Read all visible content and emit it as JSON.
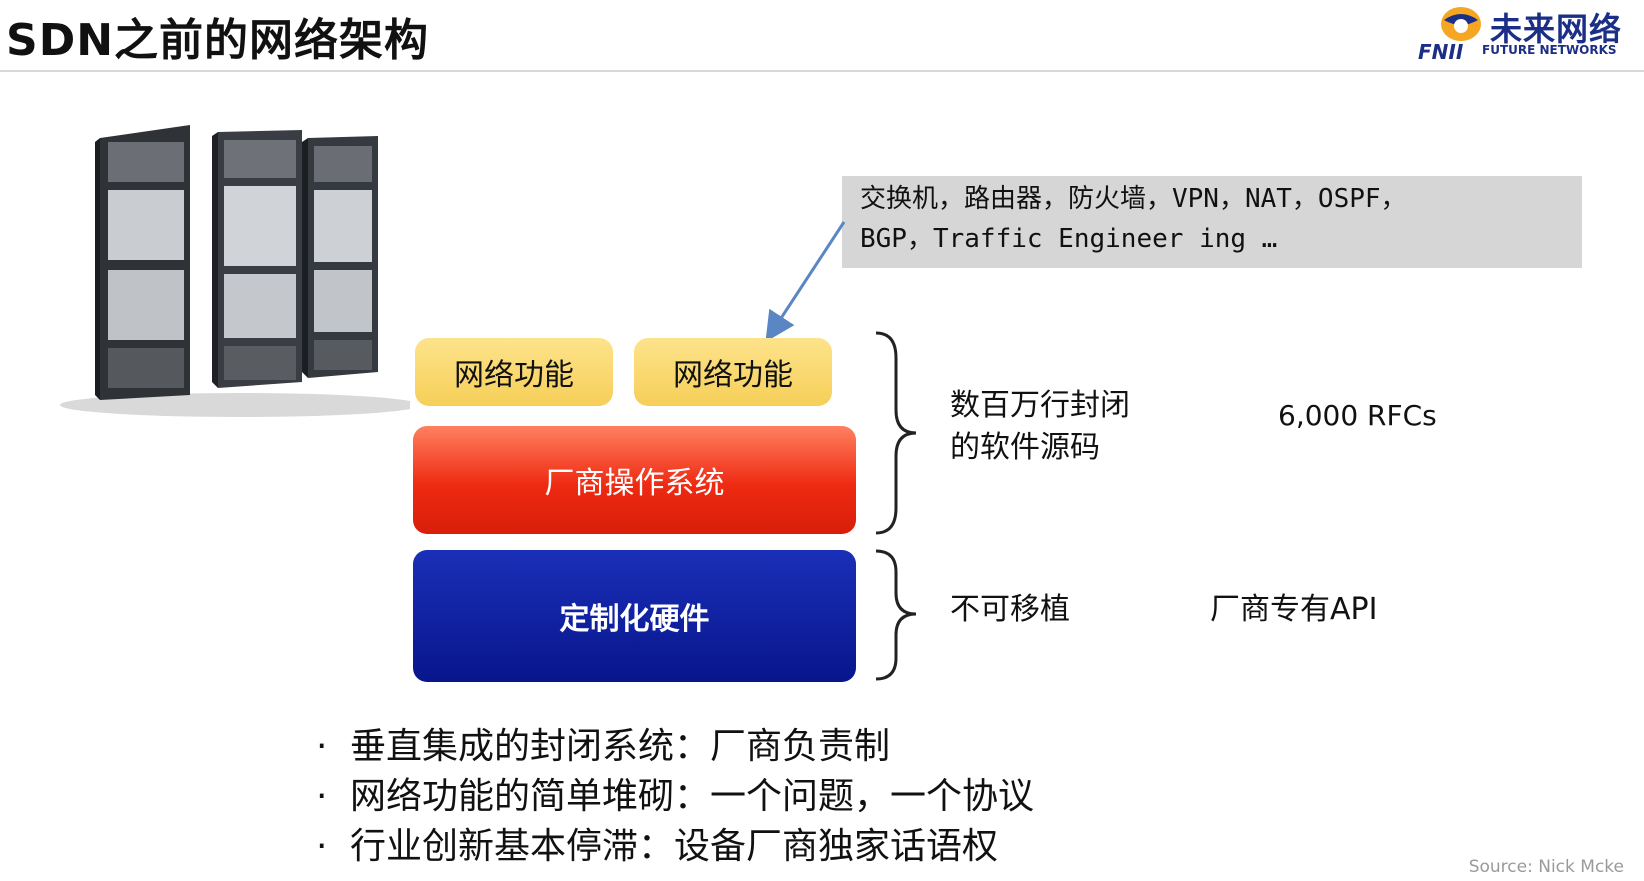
{
  "slide": {
    "title": "SDN之前的网络架构",
    "logo": {
      "cn": "未来网络",
      "abbr": "FNII",
      "en": "FUTURE NETWORKS"
    },
    "callout": {
      "line1": "交换机，路由器，防火墙，VPN，NAT，OSPF，",
      "line2": "BGP，Traffic Engineer ing …"
    },
    "stack": {
      "function_left": "网络功能",
      "function_right": "网络功能",
      "os": "厂商操作系统",
      "hardware": "定制化硬件"
    },
    "annotations": {
      "software_line1": "数百万行封闭",
      "software_line2": "的软件源码",
      "rfcs": "6,000 RFCs",
      "not_portable": "不可移植",
      "vendor_api": "厂商专有API"
    },
    "bullets": [
      "垂直集成的封闭系统：厂商负责制",
      "网络功能的简单堆砌：一个问题，一个协议",
      "行业创新基本停滞：设备厂商独家话语权"
    ],
    "source": "Source: Nick Mcke"
  }
}
